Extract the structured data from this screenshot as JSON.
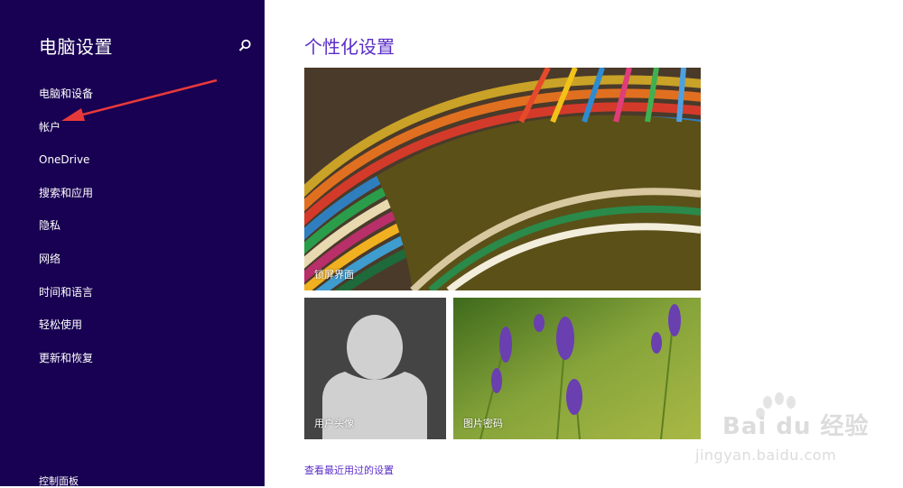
{
  "sidebar": {
    "title": "电脑设置",
    "items": [
      {
        "label": "电脑和设备"
      },
      {
        "label": "帐户"
      },
      {
        "label": "OneDrive"
      },
      {
        "label": "搜索和应用"
      },
      {
        "label": "隐私"
      },
      {
        "label": "网络"
      },
      {
        "label": "时间和语言"
      },
      {
        "label": "轻松使用"
      },
      {
        "label": "更新和恢复"
      }
    ],
    "footer": "控制面板"
  },
  "main": {
    "title": "个性化设置",
    "tiles": {
      "lock_screen": "锁屏界面",
      "account_picture": "用户头像",
      "picture_password": "图片密码"
    },
    "recent_link": "查看最近用过的设置"
  },
  "watermark": {
    "brand": "Bai du 经验",
    "url": "jingyan.baidu.com"
  },
  "colors": {
    "sidebar_bg": "#180052",
    "accent": "#5a2dc8",
    "arrow": "#e8393a"
  }
}
